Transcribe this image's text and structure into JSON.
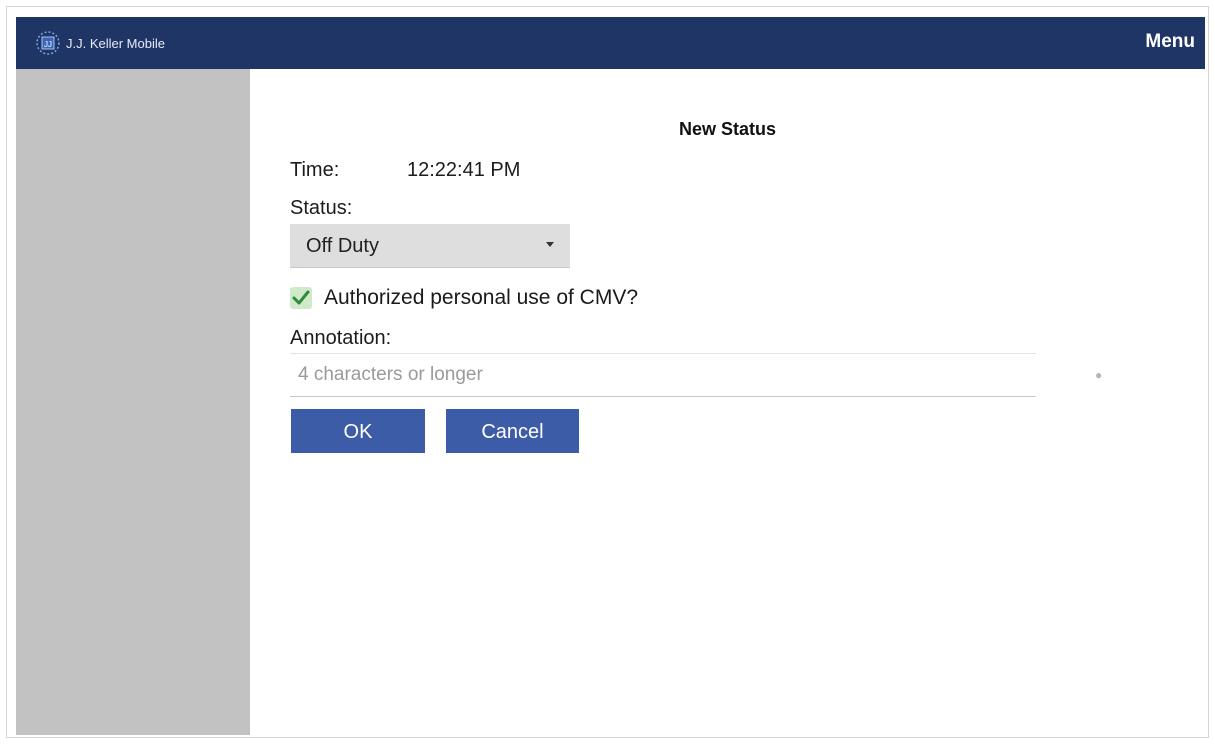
{
  "header": {
    "app_title": "J.J. Keller Mobile",
    "menu_label": "Menu",
    "logo_icon": "jj-keller-logo-icon",
    "bar_color": "#1e3566"
  },
  "dialog": {
    "title": "New Status",
    "time_label": "Time:",
    "time_value": "12:22:41 PM",
    "status_label": "Status:",
    "status_value": "Off Duty",
    "personal_use_label": "Authorized personal use of CMV?",
    "personal_use_checked": true,
    "annotation_label": "Annotation:",
    "annotation_value": "",
    "annotation_placeholder": "4 characters or longer",
    "ok_label": "OK",
    "cancel_label": "Cancel",
    "button_color": "#3d5ca8"
  }
}
